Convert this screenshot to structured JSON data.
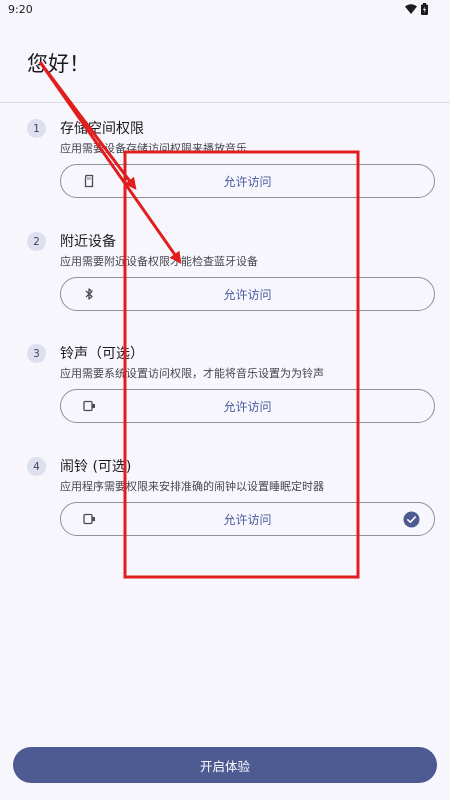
{
  "status_bar": {
    "time": "9:20"
  },
  "page": {
    "title": "您好！"
  },
  "permissions": [
    {
      "number": "1",
      "title": "存储空间权限",
      "description": "应用需要设备存储访问权限来播放音乐",
      "button_label": "允许访问",
      "icon": "storage-icon",
      "granted": false
    },
    {
      "number": "2",
      "title": "附近设备",
      "description": "应用需要附近设备权限才能检查蓝牙设备",
      "button_label": "允许访问",
      "icon": "bluetooth-icon",
      "granted": false
    },
    {
      "number": "3",
      "title": "铃声（可选）",
      "description": "应用需要系统设置访问权限，才能将音乐设置为为铃声",
      "button_label": "允许访问",
      "icon": "phone-settings-icon",
      "granted": false
    },
    {
      "number": "4",
      "title": "闹铃 (可选)",
      "description": "应用程序需要权限来安排准确的闹钟以设置睡眠定时器",
      "button_label": "允许访问",
      "icon": "alarm-settings-icon",
      "granted": true
    }
  ],
  "footer": {
    "start_label": "开启体验"
  },
  "colors": {
    "accent": "#4e5b93",
    "annotation": "#e01e1e"
  }
}
